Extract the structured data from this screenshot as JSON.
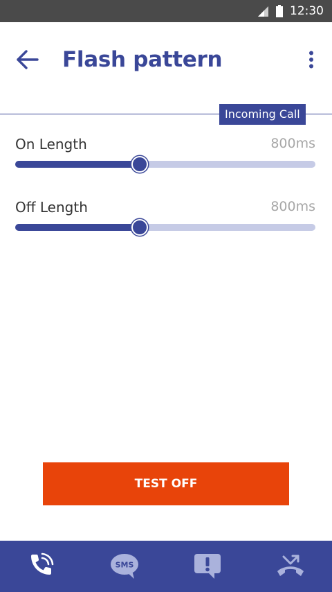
{
  "status_bar": {
    "time": "12:30",
    "icons": [
      "signal-icon",
      "battery-icon"
    ]
  },
  "header": {
    "back_icon": "arrow-left-icon",
    "title": "Flash pattern",
    "menu_icon": "more-vertical-icon",
    "context_badge": "Incoming Call"
  },
  "settings": [
    {
      "label": "On Length",
      "value": "800ms",
      "fraction": 0.414
    },
    {
      "label": "Off Length",
      "value": "800ms",
      "fraction": 0.414
    }
  ],
  "test_button": {
    "label": "TEST OFF"
  },
  "bottom_nav": {
    "items": [
      {
        "icon": "phone-call-icon",
        "label": ""
      },
      {
        "icon": "sms-icon",
        "label": "SMS"
      },
      {
        "icon": "alert-message-icon",
        "label": ""
      },
      {
        "icon": "missed-call-icon",
        "label": ""
      }
    ]
  },
  "colors": {
    "primary": "#3a4798",
    "accent": "#e8440a",
    "track": "#c6cbe6",
    "status_bar": "#4a4a4a",
    "value_text": "#a6a6a6"
  }
}
